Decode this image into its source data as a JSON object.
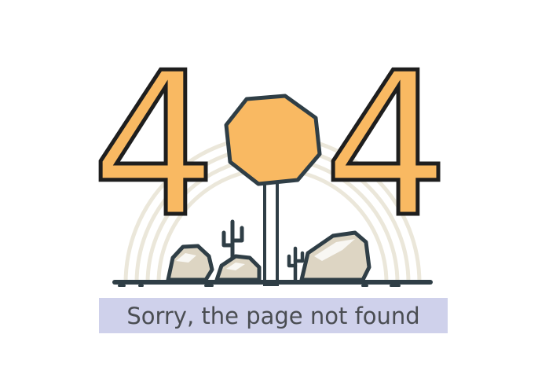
{
  "error_page": {
    "left_digit": "4",
    "right_digit": "4",
    "message": "Sorry, the page not found"
  },
  "colors": {
    "accent_orange": "#f9b962",
    "outline": "#2f3e46",
    "arc": "#ebe7da",
    "rock": "#ddd5c3",
    "banner": "#cfd1eb",
    "message_text": "#4a4d52"
  },
  "icons": [
    "stop-sign-icon",
    "cactus-icon",
    "rock-icon"
  ]
}
